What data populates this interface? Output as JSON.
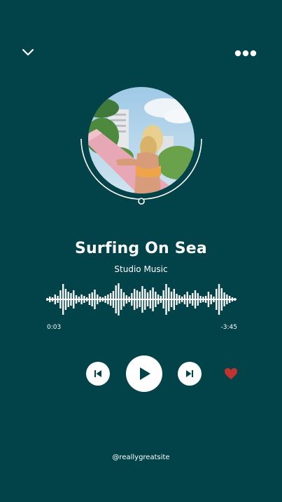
{
  "icons": {
    "collapse": "chevron-down-icon",
    "menu": "more-horizontal-icon",
    "previous": "skip-previous-icon",
    "play": "play-icon",
    "next": "skip-next-icon",
    "favorite": "heart-icon"
  },
  "track": {
    "title": "Surfing On Sea",
    "artist": "Studio Music",
    "elapsed": "0:03",
    "remaining": "-3:45",
    "favorited": true
  },
  "footer": {
    "handle": "@reallygreatsite"
  },
  "colors": {
    "background": "#02434a",
    "foreground": "#ffffff",
    "favorite": "#c0332f"
  }
}
